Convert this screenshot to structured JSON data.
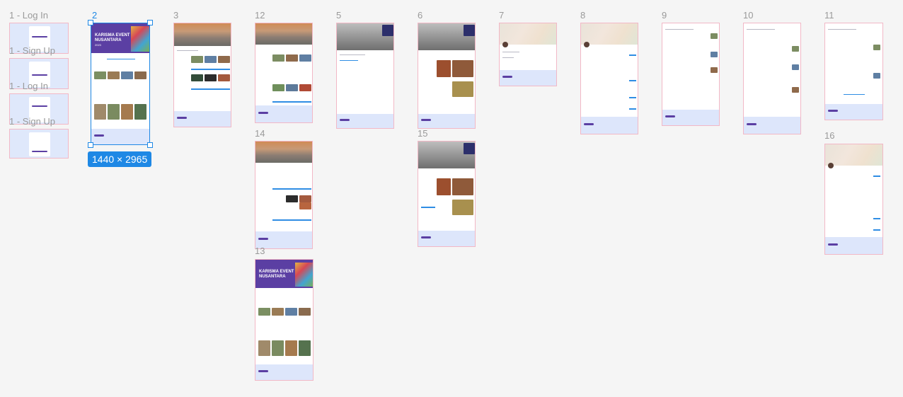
{
  "canvas": {
    "background": "#f5f5f5",
    "accent": "#1e88e5",
    "frame_border": "#f2b8c6",
    "brand_purple": "#5b3fa3"
  },
  "frames": [
    {
      "label": "1 - Log In"
    },
    {
      "label": "1 - Sign Up"
    },
    {
      "label": "1 - Log In"
    },
    {
      "label": "1 - Sign Up"
    },
    {
      "label": "2",
      "selected": true
    },
    {
      "label": "3"
    },
    {
      "label": "12"
    },
    {
      "label": "14"
    },
    {
      "label": "13"
    },
    {
      "label": "5"
    },
    {
      "label": "6"
    },
    {
      "label": "15"
    },
    {
      "label": "7"
    },
    {
      "label": "8"
    },
    {
      "label": "9"
    },
    {
      "label": "10"
    },
    {
      "label": "11"
    },
    {
      "label": "16"
    }
  ],
  "selection": {
    "size_badge": "1440 × 2965"
  },
  "hero_text": {
    "title_line1": "KARISMA EVENT",
    "title_line2": "NUSANTARA",
    "year": "2023"
  }
}
